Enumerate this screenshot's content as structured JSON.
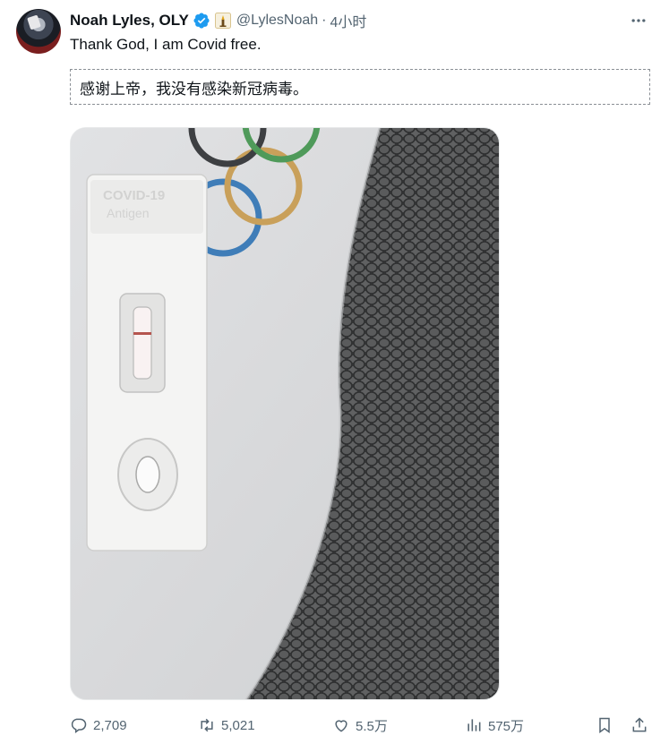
{
  "tweet": {
    "author": {
      "display_name": "Noah Lyles, OLY",
      "handle": "@LylesNoah",
      "verified": true
    },
    "separator": "·",
    "time": "4小时",
    "text": "Thank God, I am Covid free.",
    "translation": "感谢上帝，我没有感染新冠病毒。"
  },
  "actions": {
    "replies": "2,709",
    "reposts": "5,021",
    "likes": "5.5万",
    "views": "575万"
  },
  "icons": {
    "verified": "verified-badge-icon",
    "olympic": "olympic-torch-icon",
    "more": "more-options-icon",
    "reply": "reply-icon",
    "repost": "repost-icon",
    "like": "heart-icon",
    "views": "bar-chart-icon",
    "bookmark": "bookmark-icon",
    "share": "share-icon"
  },
  "colors": {
    "verified_blue": "#1d9bf0",
    "text_primary": "#0f1419",
    "text_secondary": "#536471"
  }
}
